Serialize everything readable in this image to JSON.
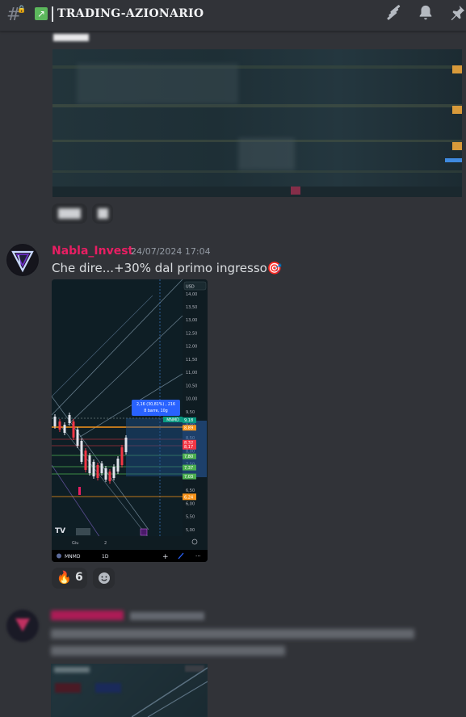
{
  "header": {
    "channel_name": "TRADING-AZIONARIO",
    "channel_emoji": "chart-emoji"
  },
  "messages": [
    {
      "username": "Nabla_Invest",
      "timestamp": "24/07/2024 17:04",
      "text": "Che dire...+30% dal primo ingresso",
      "text_emoji": "🎯",
      "chart": {
        "currency": "USD",
        "price_ticks": [
          "14,00",
          "13,50",
          "13,00",
          "12,50",
          "12,00",
          "11,50",
          "11,00",
          "10,50",
          "10,00",
          "9,50",
          "9,00",
          "8,50",
          "8,00",
          "7,50",
          "7,00",
          "6,50",
          "6,00",
          "5,50",
          "5,00"
        ],
        "tooltip_line1": "2,16 (30,81%) , 216",
        "tooltip_line2": "8 barre, 10g",
        "ticker_label": "MNMD",
        "price_tags": [
          {
            "text": "9,18",
            "color": "#089981"
          },
          {
            "text": "8,89",
            "color": "#f7931a"
          },
          {
            "text": "8,32",
            "color": "#f23645"
          },
          {
            "text": "8,17",
            "color": "#f23645"
          },
          {
            "text": "7,80",
            "color": "#4caf50"
          },
          {
            "text": "7,37",
            "color": "#4caf50"
          },
          {
            "text": "7,03",
            "color": "#4caf50"
          },
          {
            "text": "6,27",
            "color": "#f7931a"
          },
          {
            "text": "6,24",
            "color": "#f7931a"
          }
        ],
        "x_ticks": [
          "Giu",
          "2"
        ],
        "date_badge": "mar   ven 23 Ago '24",
        "footer_ticker": "MNMD",
        "footer_interval": "1D",
        "logo": "TV"
      },
      "reactions": [
        {
          "emoji": "🔥",
          "count": "6"
        }
      ]
    }
  ],
  "colors": {
    "background": "#313338",
    "username": "#e91e63",
    "chart_bg": "#0e1e25"
  }
}
